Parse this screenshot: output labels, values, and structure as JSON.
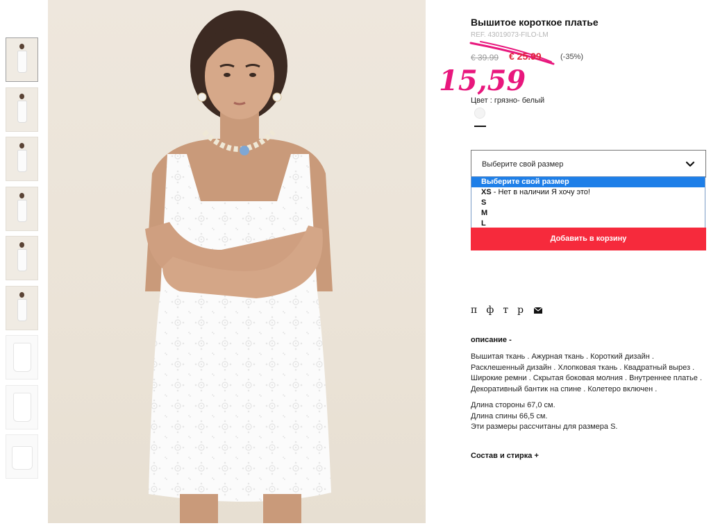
{
  "product": {
    "title": "Вышитое короткое платье",
    "ref": "REF. 43019073-FILO-LM",
    "price_old": "€ 39.99",
    "price_sale": "€ 25.99",
    "discount": "(-35%)",
    "handwritten_price": "15,59",
    "color_label": "Цвет : грязно- белый",
    "color_swatch_hex": "#f4f4f4"
  },
  "size": {
    "select_label": "Выберите свой размер",
    "options": [
      {
        "label": "Выберите свой размер",
        "note": ""
      },
      {
        "label": "XS",
        "note": " - Нет в наличии Я хочу это!"
      },
      {
        "label": "S",
        "note": ""
      },
      {
        "label": "M",
        "note": ""
      },
      {
        "label": "L",
        "note": ""
      }
    ]
  },
  "actions": {
    "add_to_cart": "Добавить в корзину"
  },
  "share": {
    "items": [
      "п",
      "ф",
      "т",
      "р"
    ],
    "mail_icon": "mail-icon"
  },
  "description": {
    "heading": "описание -",
    "text1": "Вышитая ткань . Ажурная ткань . Короткий дизайн . Расклешенный дизайн . Хлопковая ткань . Квадратный вырез . Широкие ремни . Скрытая боковая молния . Внутреннее платье . Декоративный бантик на спине . Колетеро включен .",
    "line1": "Длина стороны 67,0 см.",
    "line2": "Длина спины 66,5 см.",
    "line3": "Эти размеры рассчитаны для размера S."
  },
  "composition": {
    "heading": "Состав и стирка +"
  },
  "colors": {
    "accent_red": "#f62a3c",
    "sale_red": "#e0263a",
    "handwritten_pink": "#e8177d",
    "dropdown_highlight": "#1e7fe8"
  }
}
